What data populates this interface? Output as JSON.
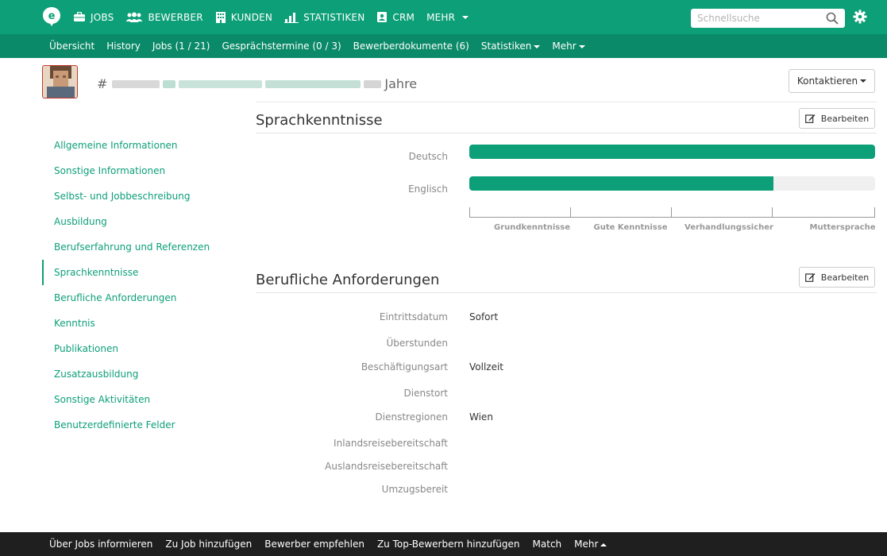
{
  "colors": {
    "brand": "#0d9f78",
    "brand_dark": "#0a8a68",
    "footer": "#1f1f1f"
  },
  "topnav": {
    "logo": "e-logo",
    "items": [
      {
        "label": "JOBS",
        "icon": "briefcase-icon"
      },
      {
        "label": "BEWERBER",
        "icon": "users-icon"
      },
      {
        "label": "KUNDEN",
        "icon": "building-icon"
      },
      {
        "label": "STATISTIKEN",
        "icon": "bar-chart-icon"
      },
      {
        "label": "CRM",
        "icon": "contact-card-icon"
      }
    ],
    "more_label": "MEHR",
    "search_placeholder": "Schnellsuche",
    "settings_icon": "gear-icon"
  },
  "subnav": {
    "items": [
      "Übersicht",
      "History",
      "Jobs (1 / 21)",
      "Gesprächstermine (0 / 3)",
      "Bewerberdokumente (6)"
    ],
    "stats_label": "Statistiken",
    "more_label": "Mehr"
  },
  "profile": {
    "hash": "#",
    "age_suffix": "Jahre",
    "contact_label": "Kontaktieren"
  },
  "sidebar": {
    "items": [
      "Allgemeine Informationen",
      "Sonstige Informationen",
      "Selbst- und Jobbeschreibung",
      "Ausbildung",
      "Berufserfahrung und Referenzen",
      "Sprachkenntnisse",
      "Berufliche Anforderungen",
      "Kenntnis",
      "Publikationen",
      "Zusatzausbildung",
      "Sonstige Aktivitäten",
      "Benutzerdefinierte Felder"
    ],
    "active": "Sprachkenntnisse"
  },
  "languages": {
    "title": "Sprachkenntnisse",
    "edit_label": "Bearbeiten",
    "items": [
      {
        "name": "Deutsch",
        "level_fraction": 1.0
      },
      {
        "name": "Englisch",
        "level_fraction": 0.75
      }
    ],
    "scale": [
      "Grundkenntnisse",
      "Gute Kenntnisse",
      "Verhandlungssicher",
      "Muttersprache"
    ]
  },
  "requirements": {
    "title": "Berufliche Anforderungen",
    "edit_label": "Bearbeiten",
    "rows": [
      {
        "label": "Eintrittsdatum",
        "value": "Sofort"
      },
      {
        "label": "Überstunden",
        "value": ""
      },
      {
        "label": "Beschäftigungsart",
        "value": "Vollzeit"
      },
      {
        "label": "Dienstort",
        "value": ""
      },
      {
        "label": "Dienstregionen",
        "value": "Wien"
      },
      {
        "label": "Inlandsreisebereitschaft",
        "value": ""
      },
      {
        "label": "Auslandsreisebereitschaft",
        "value": ""
      },
      {
        "label": "Umzugsbereit",
        "value": ""
      }
    ]
  },
  "footer": {
    "items": [
      "Über Jobs informieren",
      "Zu Job hinzufügen",
      "Bewerber empfehlen",
      "Zu Top-Bewerbern hinzufügen",
      "Match"
    ],
    "more_label": "Mehr"
  }
}
